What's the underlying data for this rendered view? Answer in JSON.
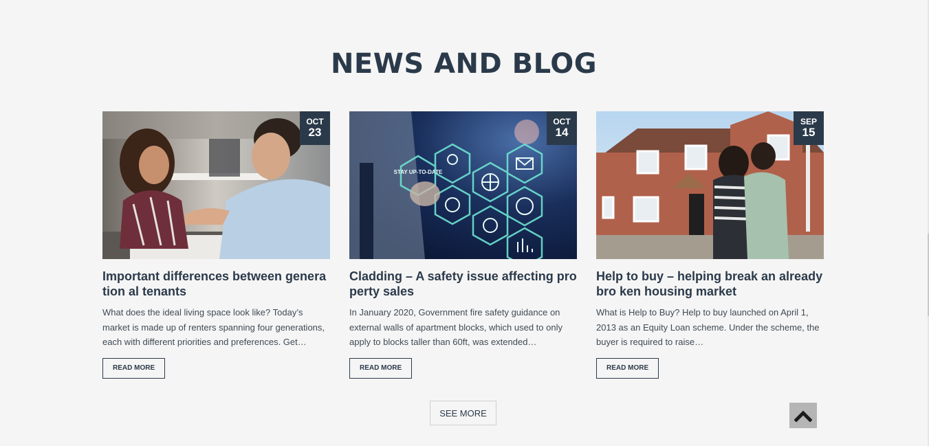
{
  "section": {
    "title": "NEWS AND BLOG"
  },
  "posts": [
    {
      "month": "OCT",
      "day": "23",
      "title": "Important differences between generation al tenants",
      "excerpt": "What does the ideal living space look like? Today’s market is made up of renters spanning four generations, each with different priorities and preferences. Get…",
      "read_more": "READ MORE",
      "image": "handshake-office-photo"
    },
    {
      "month": "OCT",
      "day": "14",
      "title": "Cladding – A safety issue affecting property sales",
      "excerpt": "In January 2020, Government fire safety guidance on external walls of apartment blocks, which used to only apply to blocks taller than 60ft, was extended…",
      "read_more": "READ MORE",
      "image": "digital-hexagon-icons-photo",
      "image_text": "STAY UP-TO-DATE"
    },
    {
      "month": "SEP",
      "day": "15",
      "title": "Help to buy – helping break an already bro ken housing market",
      "excerpt": "What is Help to Buy? Help to buy launched on April 1, 2013 as an Equity Loan scheme. Under the scheme, the buyer is required to raise…",
      "read_more": "READ MORE",
      "image": "couple-new-house-photo"
    }
  ],
  "see_more": "SEE MORE",
  "colors": {
    "primary": "#2b3a4a",
    "background": "#f5f5f5",
    "to_top": "#b5b5b5"
  },
  "icons": {
    "to_top": "chevron-up-icon"
  }
}
